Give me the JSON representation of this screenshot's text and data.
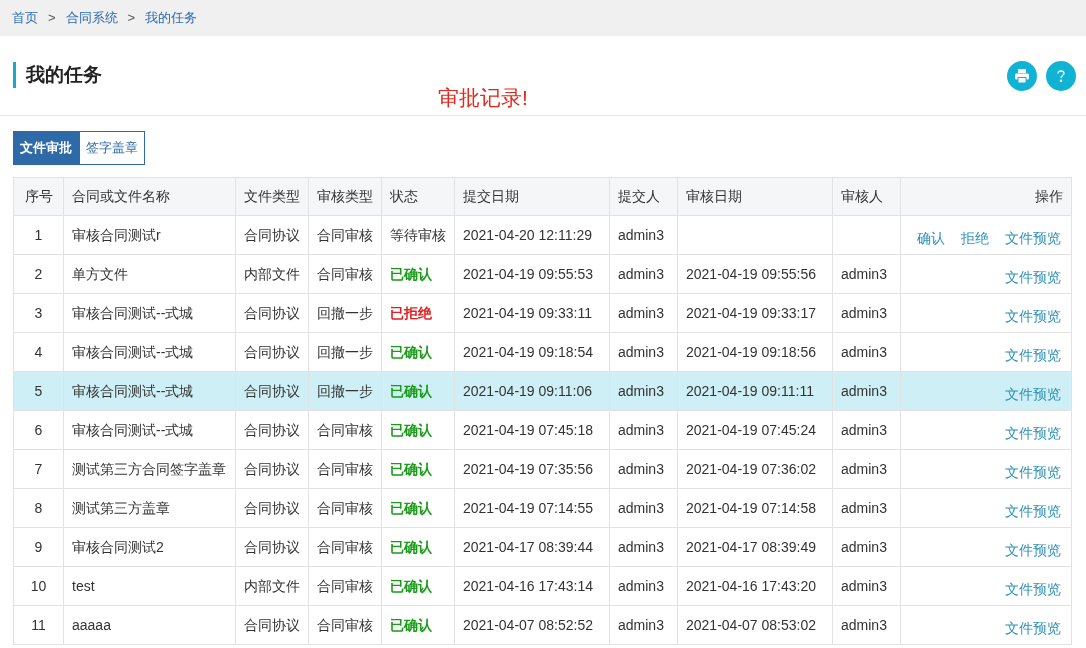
{
  "breadcrumb": [
    "首页",
    "合同系统",
    "我的任务"
  ],
  "breadcrumb_separator": ">",
  "page_title": "我的任务",
  "notice": "审批记录!",
  "tabs": [
    {
      "label": "文件审批",
      "selected": true
    },
    {
      "label": "签字盖章",
      "selected": false
    }
  ],
  "table": {
    "columns": [
      "序号",
      "合同或文件名称",
      "文件类型",
      "审核类型",
      "状态",
      "提交日期",
      "提交人",
      "审核日期",
      "审核人",
      "操作"
    ],
    "rows": [
      {
        "no": "1",
        "name": "审核合同测试r",
        "file_type": "合同协议",
        "review_type": "合同审核",
        "status": {
          "kind": "pending",
          "text": "等待审核"
        },
        "submitted": "2021-04-20 12:11:29",
        "submitter": "admin3",
        "reviewed": "",
        "reviewer": "",
        "actions": [
          "确认",
          "拒绝",
          "文件预览"
        ],
        "selected": false
      },
      {
        "no": "2",
        "name": "单方文件",
        "file_type": "内部文件",
        "review_type": "合同审核",
        "status": {
          "kind": "confirmed",
          "text": "已确认"
        },
        "submitted": "2021-04-19 09:55:53",
        "submitter": "admin3",
        "reviewed": "2021-04-19 09:55:56",
        "reviewer": "admin3",
        "actions": [
          "文件预览"
        ],
        "selected": false
      },
      {
        "no": "3",
        "name": "审核合同测试--式城",
        "file_type": "合同协议",
        "review_type": "回撤一步",
        "status": {
          "kind": "rejected",
          "text": "已拒绝"
        },
        "submitted": "2021-04-19 09:33:11",
        "submitter": "admin3",
        "reviewed": "2021-04-19 09:33:17",
        "reviewer": "admin3",
        "actions": [
          "文件预览"
        ],
        "selected": false
      },
      {
        "no": "4",
        "name": "审核合同测试--式城",
        "file_type": "合同协议",
        "review_type": "回撤一步",
        "status": {
          "kind": "confirmed",
          "text": "已确认"
        },
        "submitted": "2021-04-19 09:18:54",
        "submitter": "admin3",
        "reviewed": "2021-04-19 09:18:56",
        "reviewer": "admin3",
        "actions": [
          "文件预览"
        ],
        "selected": false
      },
      {
        "no": "5",
        "name": "审核合同测试--式城",
        "file_type": "合同协议",
        "review_type": "回撤一步",
        "status": {
          "kind": "confirmed",
          "text": "已确认"
        },
        "submitted": "2021-04-19 09:11:06",
        "submitter": "admin3",
        "reviewed": "2021-04-19 09:11:11",
        "reviewer": "admin3",
        "actions": [
          "文件预览"
        ],
        "selected": true
      },
      {
        "no": "6",
        "name": "审核合同测试--式城",
        "file_type": "合同协议",
        "review_type": "合同审核",
        "status": {
          "kind": "confirmed",
          "text": "已确认"
        },
        "submitted": "2021-04-19 07:45:18",
        "submitter": "admin3",
        "reviewed": "2021-04-19 07:45:24",
        "reviewer": "admin3",
        "actions": [
          "文件预览"
        ],
        "selected": false
      },
      {
        "no": "7",
        "name": "测试第三方合同签字盖章",
        "file_type": "合同协议",
        "review_type": "合同审核",
        "status": {
          "kind": "confirmed",
          "text": "已确认"
        },
        "submitted": "2021-04-19 07:35:56",
        "submitter": "admin3",
        "reviewed": "2021-04-19 07:36:02",
        "reviewer": "admin3",
        "actions": [
          "文件预览"
        ],
        "selected": false
      },
      {
        "no": "8",
        "name": "测试第三方盖章",
        "file_type": "合同协议",
        "review_type": "合同审核",
        "status": {
          "kind": "confirmed",
          "text": "已确认"
        },
        "submitted": "2021-04-19 07:14:55",
        "submitter": "admin3",
        "reviewed": "2021-04-19 07:14:58",
        "reviewer": "admin3",
        "actions": [
          "文件预览"
        ],
        "selected": false
      },
      {
        "no": "9",
        "name": "审核合同测试2",
        "file_type": "合同协议",
        "review_type": "合同审核",
        "status": {
          "kind": "confirmed",
          "text": "已确认"
        },
        "submitted": "2021-04-17 08:39:44",
        "submitter": "admin3",
        "reviewed": "2021-04-17 08:39:49",
        "reviewer": "admin3",
        "actions": [
          "文件预览"
        ],
        "selected": false
      },
      {
        "no": "10",
        "name": "test",
        "file_type": "内部文件",
        "review_type": "合同审核",
        "status": {
          "kind": "confirmed",
          "text": "已确认"
        },
        "submitted": "2021-04-16 17:43:14",
        "submitter": "admin3",
        "reviewed": "2021-04-16 17:43:20",
        "reviewer": "admin3",
        "actions": [
          "文件预览"
        ],
        "selected": false
      },
      {
        "no": "11",
        "name": "aaaaa",
        "file_type": "合同协议",
        "review_type": "合同审核",
        "status": {
          "kind": "confirmed",
          "text": "已确认"
        },
        "submitted": "2021-04-07 08:52:52",
        "submitter": "admin3",
        "reviewed": "2021-04-07 08:53:02",
        "reviewer": "admin3",
        "actions": [
          "文件预览"
        ],
        "selected": false
      }
    ]
  }
}
